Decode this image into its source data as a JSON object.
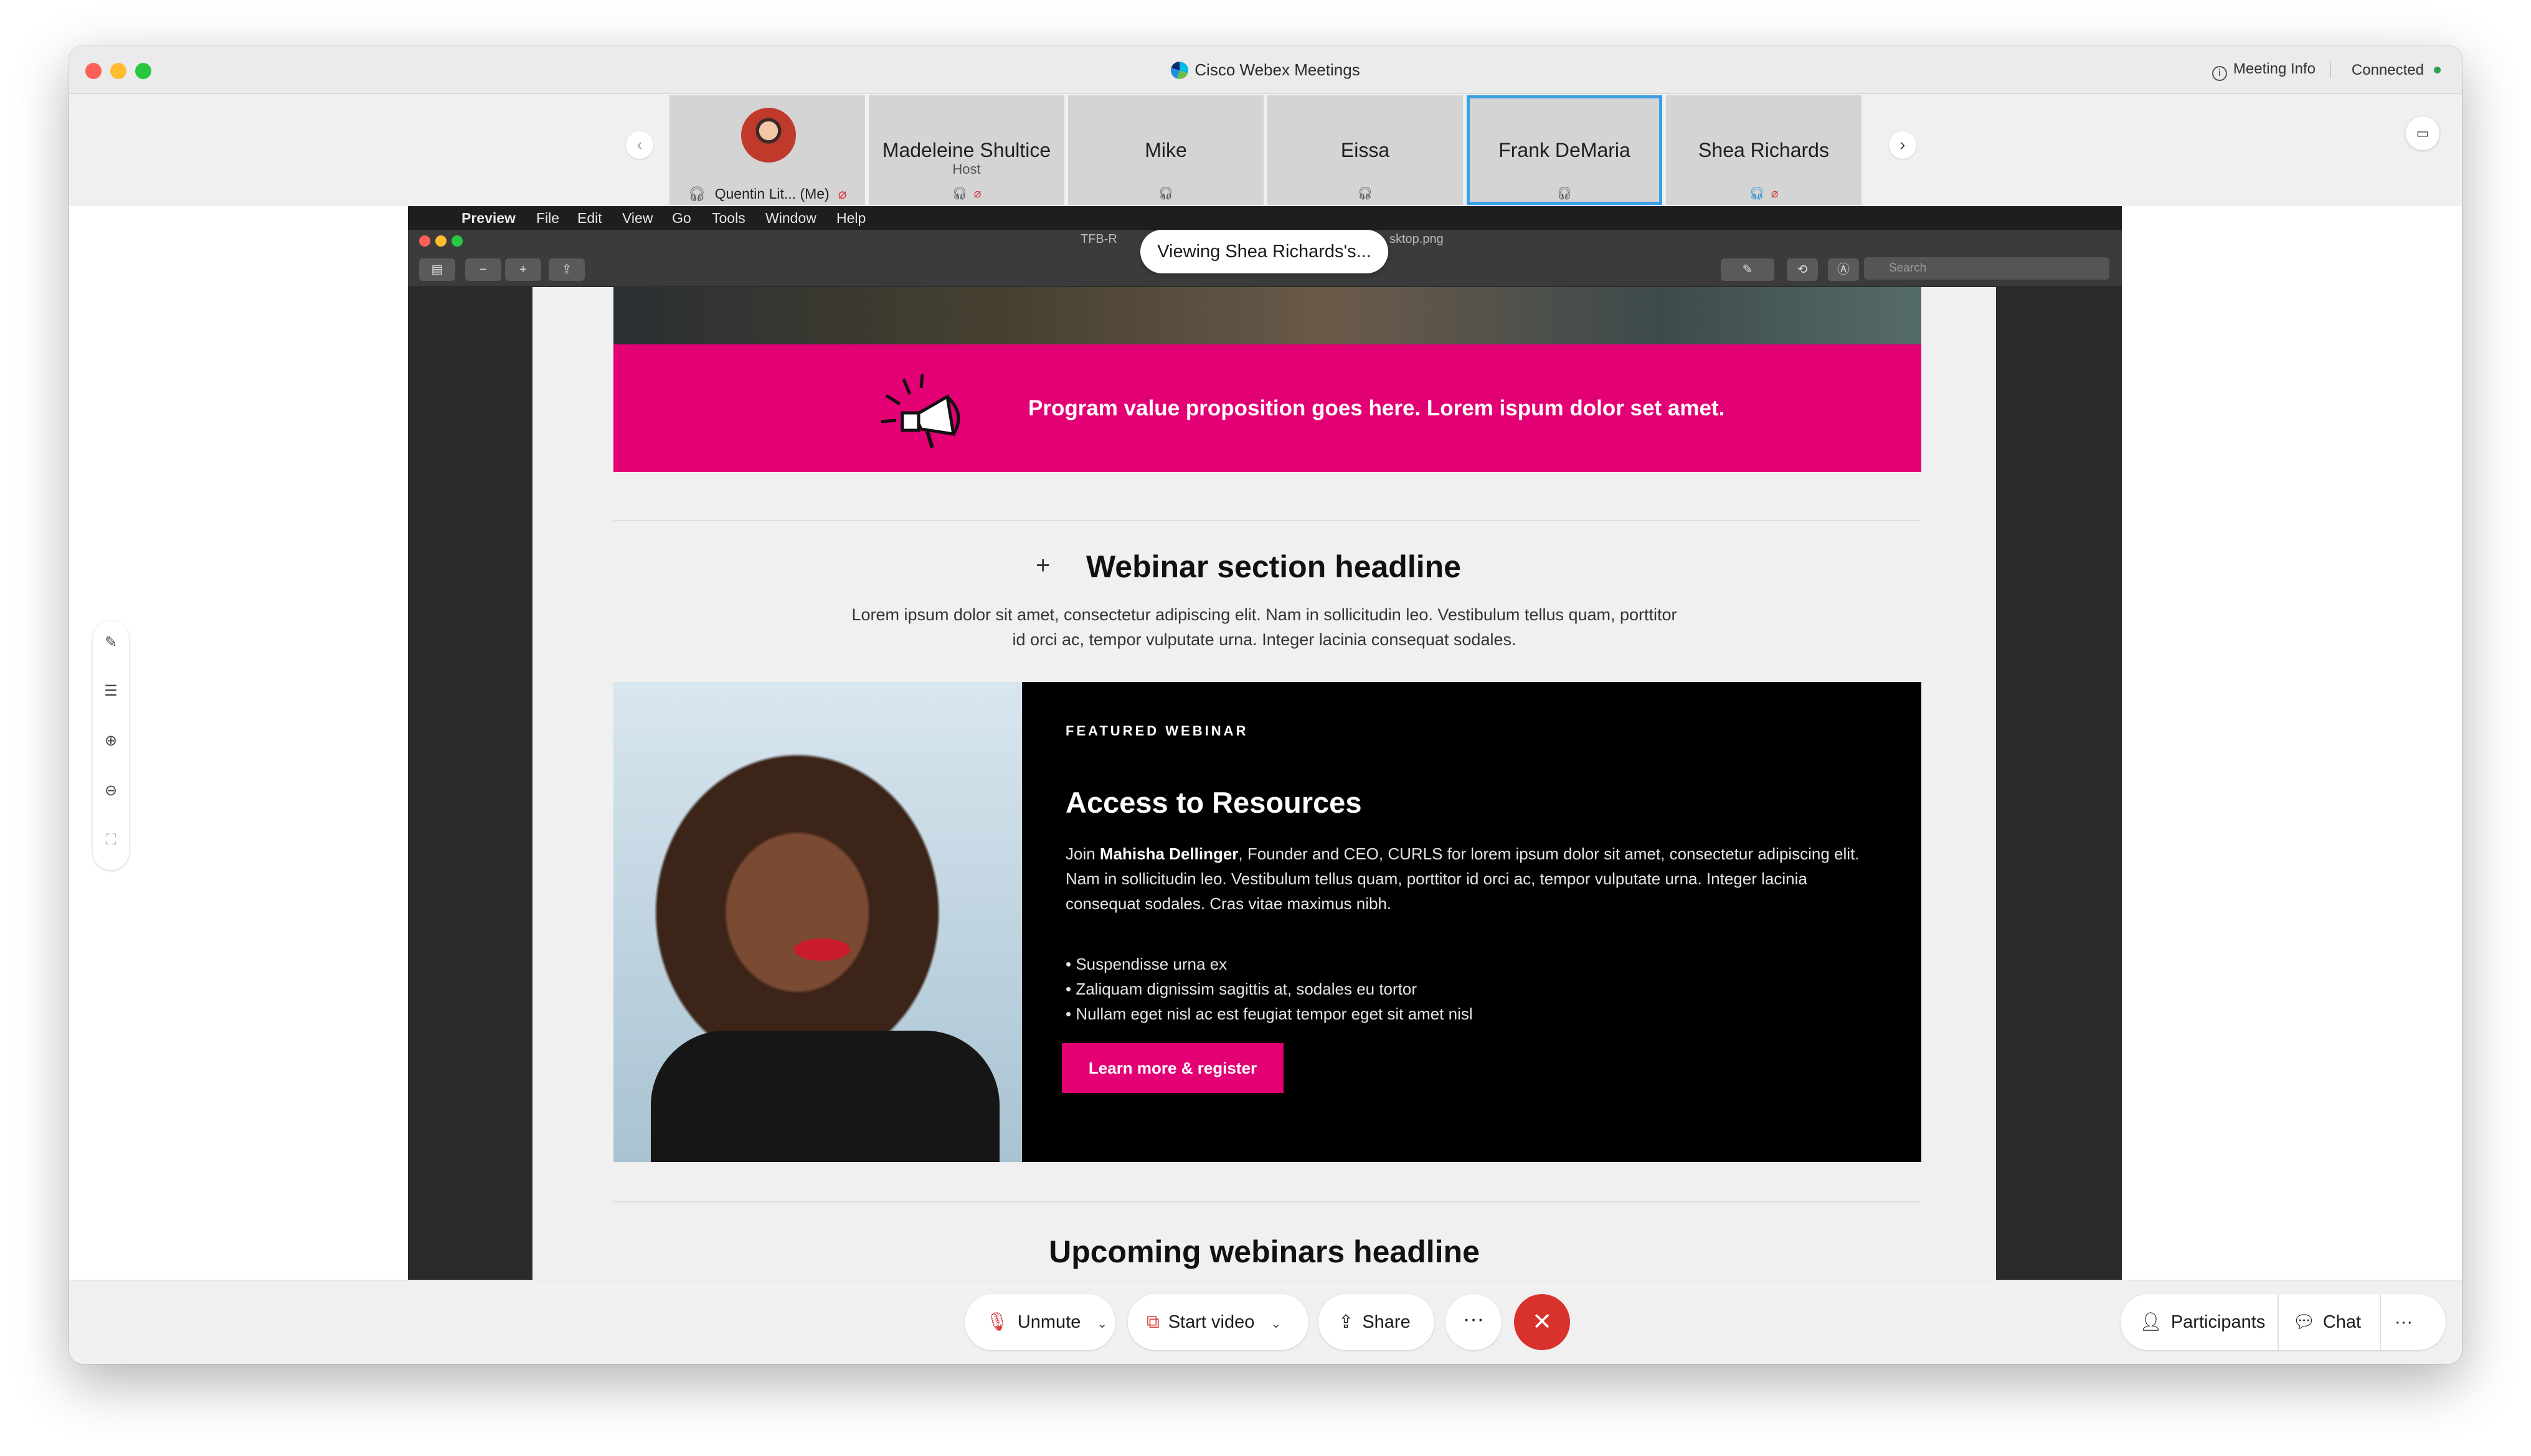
{
  "window": {
    "title": "Cisco Webex Meetings",
    "meeting_info": "Meeting Info",
    "status": "Connected"
  },
  "participants": [
    {
      "name": "Quentin Lit...",
      "suffix": "(Me)",
      "role": ""
    },
    {
      "name": "Madeleine Shultice",
      "role": "Host"
    },
    {
      "name": "Mike",
      "role": ""
    },
    {
      "name": "Eissa",
      "role": ""
    },
    {
      "name": "Frank DeMaria",
      "role": ""
    },
    {
      "name": "Shea Richards",
      "role": ""
    }
  ],
  "share": {
    "viewing_label": "Viewing Shea Richards's...",
    "file_name_left": "TFB-R",
    "file_name_right": "sktop.png",
    "search_placeholder": "Search",
    "menubar": [
      "Preview",
      "File",
      "Edit",
      "View",
      "Go",
      "Tools",
      "Window",
      "Help"
    ]
  },
  "document": {
    "banner_text": "Program value proposition goes here. Lorem ispum dolor set amet.",
    "section_headline": "Webinar section headline",
    "section_lead": "Lorem ipsum dolor sit amet, consectetur adipiscing elit. Nam in sollicitudin leo. Vestibulum tellus quam, porttitor id orci ac, tempor vulputate urna. Integer lacinia consequat sodales.",
    "feature": {
      "kicker": "FEATURED WEBINAR",
      "title": "Access to Resources",
      "body_prefix": "Join ",
      "body_name": "Mahisha Dellinger",
      "body_rest": ", Founder and CEO, CURLS for lorem ipsum dolor sit amet, consectetur adipiscing elit. Nam in sollicitudin leo. Vestibulum tellus quam, porttitor id orci ac, tempor vulputate urna. Integer lacinia consequat sodales. Cras vitae maximus nibh.",
      "bullets": [
        "Suspendisse urna ex",
        "Zaliquam dignissim sagittis at, sodales eu tortor",
        "Nullam eget nisl ac est feugiat tempor eget sit amet nisl"
      ],
      "cta": "Learn more & register"
    },
    "upcoming_headline": "Upcoming webinars headline"
  },
  "controls": {
    "unmute": "Unmute",
    "start_video": "Start video",
    "share": "Share",
    "more": "···",
    "participants": "Participants",
    "chat": "Chat",
    "overflow": "···"
  },
  "icons": {
    "mic_muted": "mic-muted-icon",
    "headset": "headset-icon",
    "end": "end-call-icon"
  },
  "colors": {
    "brand_magenta": "#e20074",
    "end_call": "#d9312b",
    "active_tile": "#3aa1e8"
  }
}
